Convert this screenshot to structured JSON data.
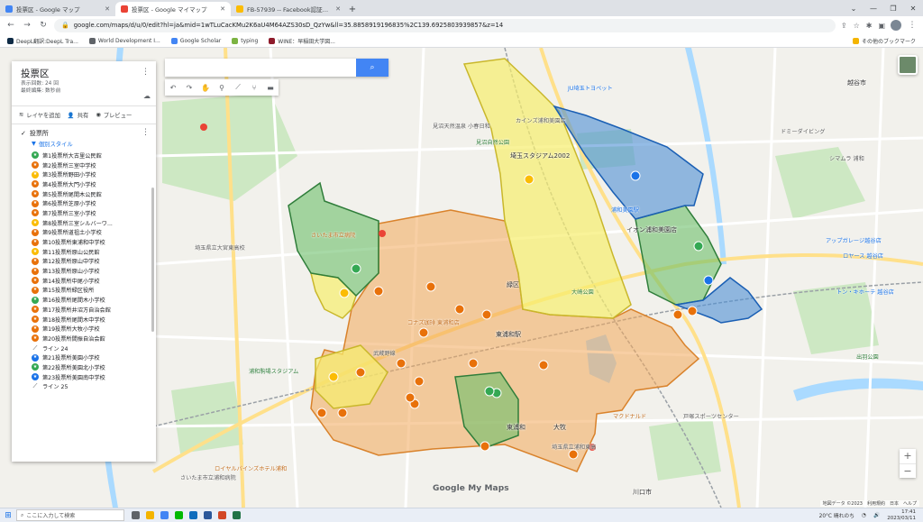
{
  "browser": {
    "tabs": [
      {
        "title": "投票区 - Google マップ",
        "color": "#4285f4",
        "active": false
      },
      {
        "title": "投票区 - Google マイマップ",
        "color": "#ea4335",
        "active": true
      },
      {
        "title": "FB-57939 -- Facebook認証コード・...",
        "color": "#fbbc04",
        "active": false
      }
    ],
    "new_tab": "+",
    "url": "google.com/maps/d/u/0/edit?hl=ja&mid=1wTLuCacKMu2K6aU4M64AZS30sD_QzYw&ll=35.8858919196835%2C139.6925803939857&z=14",
    "bookmarks": [
      {
        "label": "DeepL翻訳:DeepL Tra...",
        "color": "#0f2b46"
      },
      {
        "label": "World Development I...",
        "color": "#5f6368"
      },
      {
        "label": "Google Scholar",
        "color": "#4285f4"
      },
      {
        "label": "typing",
        "color": "#7cb342"
      },
      {
        "label": "WINE：早稲田大学図...",
        "color": "#8e1b2b"
      }
    ],
    "other_bookmarks": "その他のブックマーク"
  },
  "map_ui": {
    "search_placeholder": "",
    "attribution": "Google My Maps",
    "copyright": "地図データ ©2023　利用規約　日本　ヘルプ"
  },
  "panel": {
    "title": "投票区",
    "views": "表示回数: 24 回",
    "last_edit": "最終編集: 数秒前",
    "add_layer": "レイヤを追加",
    "share": "共有",
    "preview": "プレビュー",
    "layer_name": "投票所",
    "style_label": "個別スタイル",
    "items": [
      {
        "label": "第1投票所大古里公民館",
        "color": "#34a853",
        "kind": "point"
      },
      {
        "label": "第2投票所三室中学校",
        "color": "#e8710a",
        "kind": "point"
      },
      {
        "label": "第3投票所野田小学校",
        "color": "#fbbc04",
        "kind": "point"
      },
      {
        "label": "第4投票所大門小学校",
        "color": "#e8710a",
        "kind": "point"
      },
      {
        "label": "第5投票所尾間木公民館",
        "color": "#e8710a",
        "kind": "point"
      },
      {
        "label": "第6投票所芝原小学校",
        "color": "#e8710a",
        "kind": "point"
      },
      {
        "label": "第7投票所三室小学校",
        "color": "#e8710a",
        "kind": "point"
      },
      {
        "label": "第8投票所三室シルバーワ...",
        "color": "#fbbc04",
        "kind": "point"
      },
      {
        "label": "第9投票所道祖土小学校",
        "color": "#e8710a",
        "kind": "point"
      },
      {
        "label": "第10投票所東浦和中学校",
        "color": "#e8710a",
        "kind": "point"
      },
      {
        "label": "第11投票所原山公民館",
        "color": "#fbbc04",
        "kind": "point"
      },
      {
        "label": "第12投票所原山中学校",
        "color": "#e8710a",
        "kind": "point"
      },
      {
        "label": "第13投票所原山小学校",
        "color": "#e8710a",
        "kind": "point"
      },
      {
        "label": "第14投票所中尾小学校",
        "color": "#e8710a",
        "kind": "point"
      },
      {
        "label": "第15投票所緑区役所",
        "color": "#e8710a",
        "kind": "point"
      },
      {
        "label": "第16投票所尾間木小学校",
        "color": "#34a853",
        "kind": "point"
      },
      {
        "label": "第17投票所井沼方自治会館",
        "color": "#e8710a",
        "kind": "point"
      },
      {
        "label": "第18投票所尾間木中学校",
        "color": "#e8710a",
        "kind": "point"
      },
      {
        "label": "第19投票所大牧小学校",
        "color": "#e8710a",
        "kind": "point"
      },
      {
        "label": "第20投票所間振自治会館",
        "color": "#e8710a",
        "kind": "point"
      },
      {
        "label": "ライン 24",
        "color": "#3c4043",
        "kind": "line"
      },
      {
        "label": "第21投票所美園小学校",
        "color": "#1a73e8",
        "kind": "point"
      },
      {
        "label": "第22投票所美園北小学校",
        "color": "#34a853",
        "kind": "point"
      },
      {
        "label": "第23投票所美園南中学校",
        "color": "#1a73e8",
        "kind": "point"
      },
      {
        "label": "ライン 25",
        "color": "#3c4043",
        "kind": "line"
      }
    ]
  },
  "map_labels": [
    {
      "text": "さいたま市立病院",
      "cls": "orange"
    },
    {
      "text": "埼玉スタジアム2002",
      "cls": "big"
    },
    {
      "text": "東浦和駅",
      "cls": "big"
    },
    {
      "text": "浦和美園駅",
      "cls": "blue"
    },
    {
      "text": "イオン浦和美園店",
      "cls": "big"
    },
    {
      "text": "緑区",
      "cls": "big"
    },
    {
      "text": "大崎公園",
      "cls": "green"
    },
    {
      "text": "浦和駒場スタジアム",
      "cls": "green"
    },
    {
      "text": "見沼自然公園",
      "cls": "green"
    },
    {
      "text": "東浦和",
      "cls": "big"
    },
    {
      "text": "大牧",
      "cls": "big"
    },
    {
      "text": "埼玉県立大宮東高校",
      "cls": ""
    },
    {
      "text": "ロイヤルパインズホテル浦和",
      "cls": "orange"
    },
    {
      "text": "さいたま市立浦和病院",
      "cls": ""
    },
    {
      "text": "川口市",
      "cls": "big"
    },
    {
      "text": "越谷市",
      "cls": "big"
    },
    {
      "text": "マクドナルド",
      "cls": "orange"
    },
    {
      "text": "見沼天然温泉 小春日和",
      "cls": ""
    },
    {
      "text": "JU埼玉トヨペット",
      "cls": "blue"
    },
    {
      "text": "カインズ浦和美園店",
      "cls": ""
    },
    {
      "text": "コナズ珈琲 東浦和店",
      "cls": "orange"
    },
    {
      "text": "ドミーダイビング",
      "cls": ""
    },
    {
      "text": "武蔵野線",
      "cls": ""
    },
    {
      "text": "シマムラ 浦和",
      "cls": ""
    },
    {
      "text": "アップガレージ越谷店",
      "cls": "blue"
    },
    {
      "text": "ロヤース 越谷店",
      "cls": "blue"
    },
    {
      "text": "トン・キホーテ 越谷店",
      "cls": "blue"
    },
    {
      "text": "出羽公園",
      "cls": "green"
    },
    {
      "text": "戸塚スポーツセンター",
      "cls": ""
    },
    {
      "text": "埼玉県立浦和東高",
      "cls": ""
    }
  ],
  "taskbar": {
    "search_placeholder": "ここに入力して検索",
    "weather": "20°C 晴れのち",
    "time": "17:41",
    "date": "2023/03/11"
  }
}
